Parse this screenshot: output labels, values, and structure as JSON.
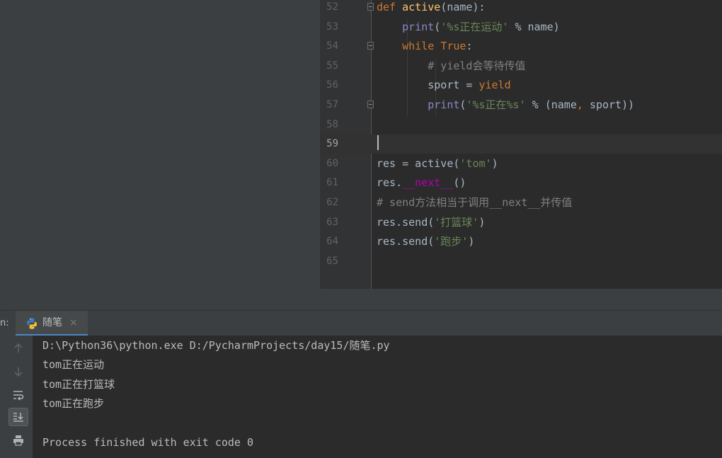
{
  "editor": {
    "lines": [
      {
        "num": "52",
        "tokens": [
          {
            "t": "def ",
            "c": "kw"
          },
          {
            "t": "active",
            "c": "fn"
          },
          {
            "t": "(name):",
            "c": ""
          }
        ]
      },
      {
        "num": "53",
        "tokens": [
          {
            "t": "    ",
            "c": ""
          },
          {
            "t": "print",
            "c": "bi"
          },
          {
            "t": "(",
            "c": ""
          },
          {
            "t": "'%s正在运动'",
            "c": "str"
          },
          {
            "t": " % name)",
            "c": ""
          }
        ]
      },
      {
        "num": "54",
        "tokens": [
          {
            "t": "    ",
            "c": ""
          },
          {
            "t": "while ",
            "c": "kw"
          },
          {
            "t": "True",
            "c": "kw"
          },
          {
            "t": ":",
            "c": ""
          }
        ]
      },
      {
        "num": "55",
        "tokens": [
          {
            "t": "        ",
            "c": ""
          },
          {
            "t": "# yield会等待传值",
            "c": "cm"
          }
        ]
      },
      {
        "num": "56",
        "tokens": [
          {
            "t": "        sport = ",
            "c": ""
          },
          {
            "t": "yield",
            "c": "kw"
          }
        ]
      },
      {
        "num": "57",
        "tokens": [
          {
            "t": "        ",
            "c": ""
          },
          {
            "t": "print",
            "c": "bi"
          },
          {
            "t": "(",
            "c": ""
          },
          {
            "t": "'%s正在%s'",
            "c": "str"
          },
          {
            "t": " % (name",
            "c": ""
          },
          {
            "t": ", ",
            "c": "kw"
          },
          {
            "t": "sport))",
            "c": ""
          }
        ]
      },
      {
        "num": "58",
        "tokens": []
      },
      {
        "num": "59",
        "tokens": []
      },
      {
        "num": "60",
        "tokens": [
          {
            "t": "res = active(",
            "c": ""
          },
          {
            "t": "'tom'",
            "c": "str"
          },
          {
            "t": ")",
            "c": ""
          }
        ]
      },
      {
        "num": "61",
        "tokens": [
          {
            "t": "res.",
            "c": ""
          },
          {
            "t": "__next__",
            "c": "magic"
          },
          {
            "t": "()",
            "c": ""
          }
        ]
      },
      {
        "num": "62",
        "tokens": [
          {
            "t": "# send方法相当于调用__next__并传值",
            "c": "cm"
          }
        ]
      },
      {
        "num": "63",
        "tokens": [
          {
            "t": "res.send(",
            "c": ""
          },
          {
            "t": "'打篮球'",
            "c": "str"
          },
          {
            "t": ")",
            "c": ""
          }
        ]
      },
      {
        "num": "64",
        "tokens": [
          {
            "t": "res.send(",
            "c": ""
          },
          {
            "t": "'跑步'",
            "c": "str"
          },
          {
            "t": ")",
            "c": ""
          }
        ]
      },
      {
        "num": "65",
        "tokens": []
      }
    ],
    "current_line": "59"
  },
  "run_panel": {
    "label": "n:",
    "tab": {
      "name": "随笔",
      "icon": "python-file-icon",
      "close": "×"
    },
    "toolbar": [
      {
        "name": "up-arrow-icon",
        "active": false
      },
      {
        "name": "down-arrow-icon",
        "active": false
      },
      {
        "name": "soft-wrap-icon",
        "active": false
      },
      {
        "name": "scroll-to-end-icon",
        "active": true
      },
      {
        "name": "print-icon",
        "active": false
      }
    ],
    "output": [
      "D:\\Python36\\python.exe D:/PycharmProjects/day15/随笔.py",
      "tom正在运动",
      "tom正在打篮球",
      "tom正在跑步",
      "",
      "Process finished with exit code 0"
    ]
  },
  "colors": {
    "keyword": "#cc7832",
    "function": "#ffc66d",
    "builtin": "#8888c6",
    "string": "#6a8759",
    "comment": "#808080",
    "magic": "#b200b2",
    "text": "#a9b7c6",
    "background": "#2b2b2b",
    "accent": "#4a88c7"
  }
}
